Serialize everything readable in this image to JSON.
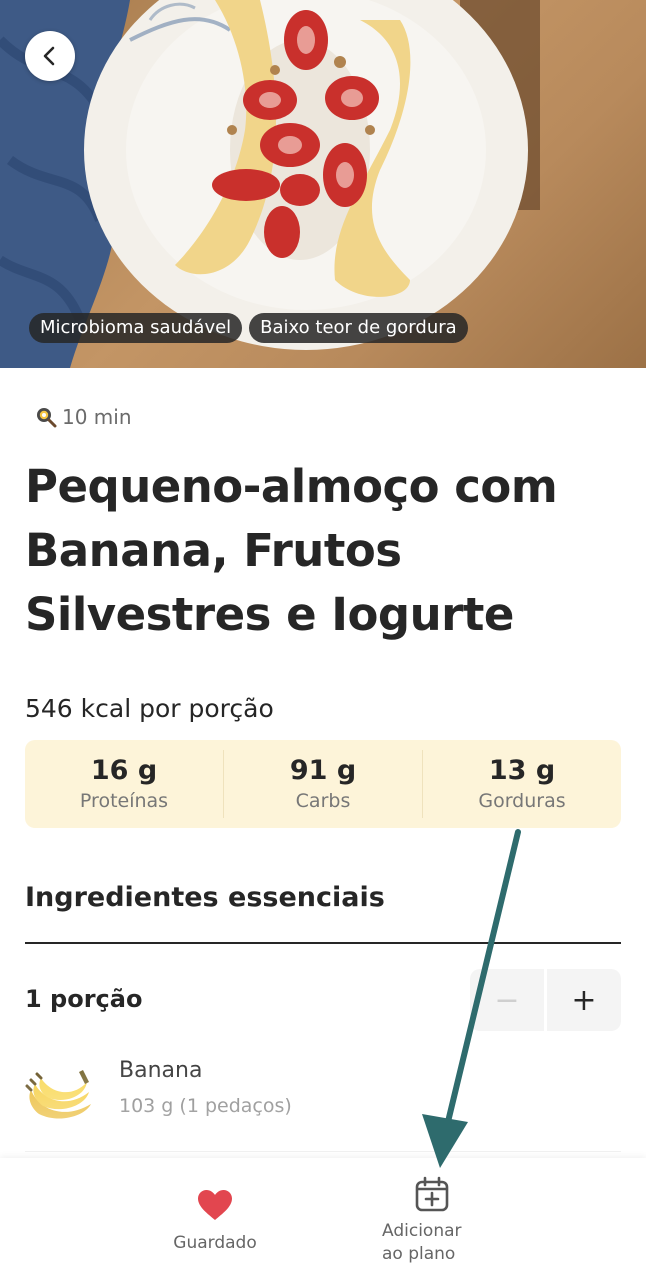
{
  "hero": {
    "tags": [
      "Microbioma saudável",
      "Baixo teor de gordura"
    ]
  },
  "recipe": {
    "time": "10 min",
    "title": "Pequeno-almoço com Banana, Frutos Silvestres e Iogurte",
    "calories": "546 kcal por porção",
    "macros": [
      {
        "value": "16 g",
        "label": "Proteínas"
      },
      {
        "value": "91 g",
        "label": "Carbs"
      },
      {
        "value": "13 g",
        "label": "Gorduras"
      }
    ]
  },
  "ingredients": {
    "section_title": "Ingredientes essenciais",
    "portion_label": "1 porção",
    "stepper": {
      "minus": "−",
      "plus": "+"
    },
    "items": [
      {
        "name": "Banana",
        "quantity": "103 g (1 pedaços)"
      }
    ]
  },
  "bottom_nav": {
    "saved_label": "Guardado",
    "add_plan_label_line1": "Adicionar",
    "add_plan_label_line2": "ao plano"
  },
  "colors": {
    "macro_bg": "#fdf4d9",
    "heart": "#e2464f",
    "annotation_arrow": "#2e6b6d"
  },
  "icons": [
    "back-arrow-icon",
    "clock-icon",
    "banana-image",
    "heart-icon",
    "calendar-plus-icon"
  ]
}
